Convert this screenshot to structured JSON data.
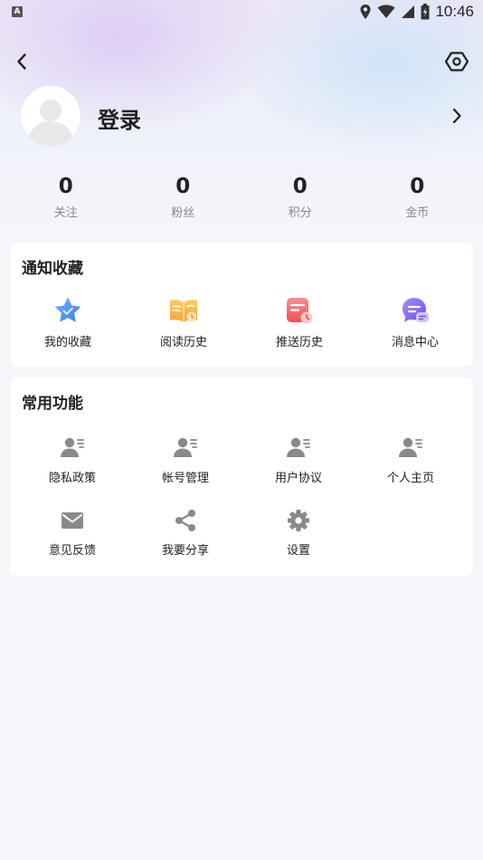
{
  "status_bar": {
    "app_icon_letter": "A",
    "time": "10:46"
  },
  "profile": {
    "login_label": "登录"
  },
  "stats": [
    {
      "value": "0",
      "label": "关注"
    },
    {
      "value": "0",
      "label": "粉丝"
    },
    {
      "value": "0",
      "label": "积分"
    },
    {
      "value": "0",
      "label": "金币"
    }
  ],
  "notify_section": {
    "title": "通知收藏",
    "items": [
      {
        "label": "我的收藏",
        "icon": "star-icon"
      },
      {
        "label": "阅读历史",
        "icon": "book-icon"
      },
      {
        "label": "推送历史",
        "icon": "push-history-icon"
      },
      {
        "label": "消息中心",
        "icon": "message-icon"
      }
    ]
  },
  "common_section": {
    "title": "常用功能",
    "items": [
      {
        "label": "隐私政策",
        "icon": "user-card-icon"
      },
      {
        "label": "帐号管理",
        "icon": "user-card-icon"
      },
      {
        "label": "用户协议",
        "icon": "user-card-icon"
      },
      {
        "label": "个人主页",
        "icon": "user-card-icon"
      },
      {
        "label": "意见反馈",
        "icon": "mail-icon"
      },
      {
        "label": "我要分享",
        "icon": "share-icon"
      },
      {
        "label": "设置",
        "icon": "gear-icon"
      }
    ]
  },
  "colors": {
    "background": "#f5f6fa",
    "card": "#ffffff",
    "text_primary": "#222222",
    "text_secondary": "#888888",
    "icon_gray": "#8a8a8a"
  }
}
